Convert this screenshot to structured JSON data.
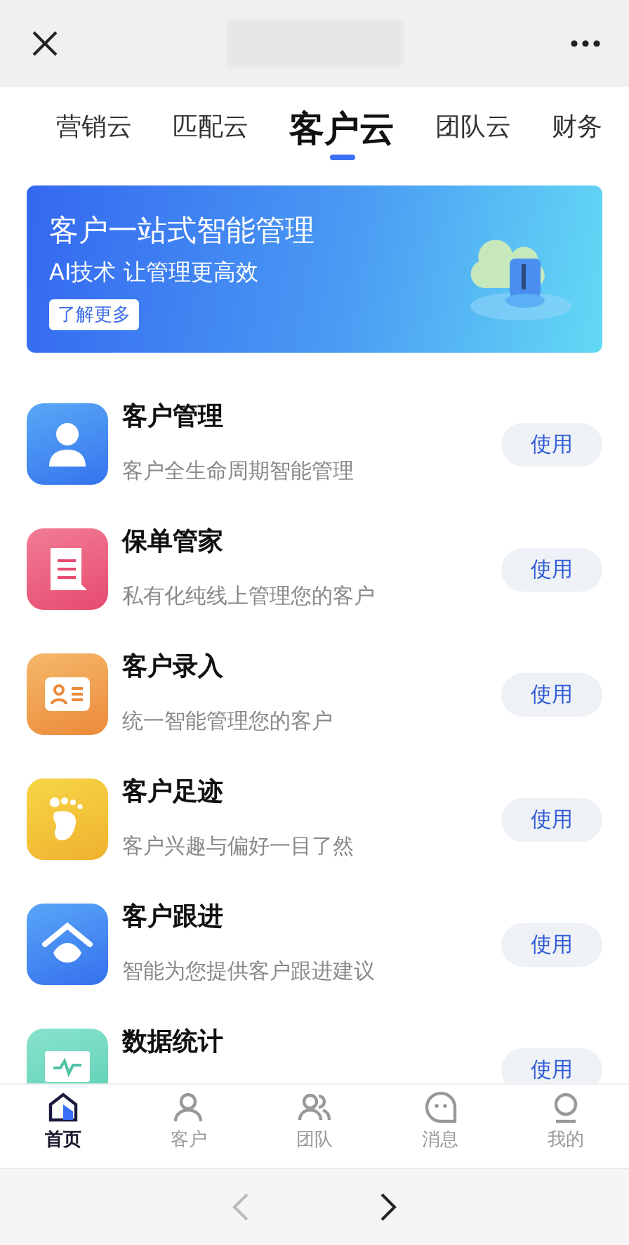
{
  "tabs": [
    {
      "label": "营销云",
      "selected": false
    },
    {
      "label": "匹配云",
      "selected": false
    },
    {
      "label": "客户云",
      "selected": true
    },
    {
      "label": "团队云",
      "selected": false
    },
    {
      "label": "财务",
      "selected": false
    }
  ],
  "banner": {
    "title": "客户一站式智能管理",
    "subtitle": "AI技术 让管理更高效",
    "button": "了解更多"
  },
  "apps": [
    {
      "kind": "person",
      "name": "客户管理",
      "description": "客户全生命周期智能管理",
      "action": "使用"
    },
    {
      "kind": "document",
      "name": "保单管家",
      "description": "私有化纯线上管理您的客户",
      "action": "使用"
    },
    {
      "kind": "card",
      "name": "客户录入",
      "description": "统一智能管理您的客户",
      "action": "使用"
    },
    {
      "kind": "foot",
      "name": "客户足迹",
      "description": "客户兴趣与偏好一目了然",
      "action": "使用"
    },
    {
      "kind": "house",
      "name": "客户跟进",
      "description": "智能为您提供客户跟进建议",
      "action": "使用"
    },
    {
      "kind": "monitor",
      "name": "数据统计",
      "action": "使用"
    }
  ],
  "tab_bar": [
    {
      "kind": "home",
      "label": "首页",
      "selected": true
    },
    {
      "kind": "person",
      "label": "客户",
      "selected": false
    },
    {
      "kind": "team",
      "label": "团队",
      "selected": false
    },
    {
      "kind": "chat",
      "label": "消息",
      "selected": false
    },
    {
      "kind": "me",
      "label": "我的",
      "selected": false
    }
  ],
  "browser_nav": {
    "back_disabled": true,
    "forward_disabled": false
  }
}
